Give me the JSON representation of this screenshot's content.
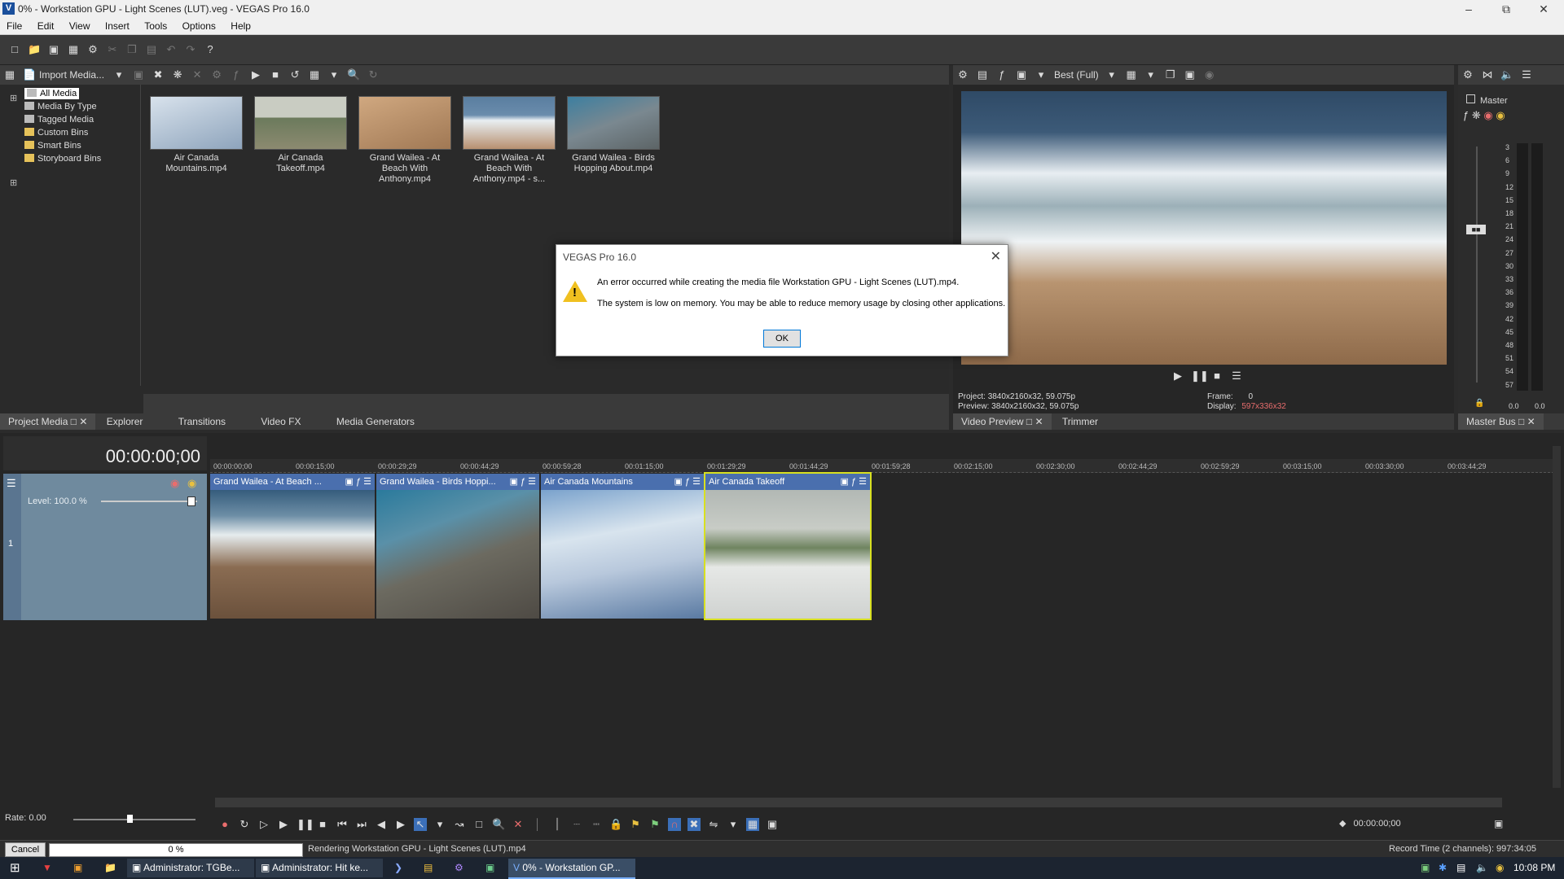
{
  "window": {
    "title": "0% - Workstation GPU - Light Scenes (LUT).veg - VEGAS Pro 16.0",
    "app_letter": "V"
  },
  "menu": [
    "File",
    "Edit",
    "View",
    "Insert",
    "Tools",
    "Options",
    "Help"
  ],
  "media_panel": {
    "import_label": "Import Media...",
    "tree": [
      "All Media",
      "Media By Type",
      "Tagged Media",
      "Custom Bins",
      "Smart Bins",
      "Storyboard Bins"
    ],
    "thumbs": [
      {
        "name": "Air Canada Mountains.mp4",
        "color": "#b8c6d4"
      },
      {
        "name": "Air Canada Takeoff.mp4",
        "color": "#8c9a88"
      },
      {
        "name": "Grand Wailea - At Beach With Anthony.mp4",
        "color": "#b08a66"
      },
      {
        "name": "Grand Wailea - At Beach With Anthony.mp4 - s...",
        "color": "#7a8ea0"
      },
      {
        "name": "Grand Wailea - Birds Hopping About.mp4",
        "color": "#6a8290"
      }
    ]
  },
  "left_tabs": [
    "Project Media",
    "Explorer",
    "Transitions",
    "Video FX",
    "Media Generators"
  ],
  "preview": {
    "quality": "Best (Full)",
    "project_label": "Project:",
    "project_value": "3840x2160x32, 59.075p",
    "preview_label": "Preview:",
    "preview_value": "3840x2160x32, 59.075p",
    "frame_label": "Frame:",
    "frame_value": "0",
    "display_label": "Display:",
    "display_value": "597x336x32",
    "tabs": [
      "Video Preview",
      "Trimmer"
    ]
  },
  "master": {
    "label": "Master",
    "scale": [
      "3",
      "6",
      "9",
      "12",
      "15",
      "18",
      "21",
      "24",
      "27",
      "30",
      "33",
      "36",
      "39",
      "42",
      "45",
      "48",
      "51",
      "54",
      "57"
    ],
    "left_value": "0.0",
    "right_value": "0.0",
    "tab": "Master Bus"
  },
  "dialog": {
    "title": "VEGAS Pro 16.0",
    "line1": "An error occurred while creating the media file Workstation GPU - Light Scenes (LUT).mp4.",
    "line2": "The system is low on memory. You may be able to reduce memory usage by closing other applications.",
    "ok": "OK"
  },
  "timeline": {
    "timecode": "00:00:00;00",
    "level": "Level: 100.0 %",
    "ruler": [
      "00:00:00;00",
      "00:00:15;00",
      "00:00:29;29",
      "00:00:44;29",
      "00:00:59;28",
      "00:01:15;00",
      "00:01:29;29",
      "00:01:44;29",
      "00:01:59;28",
      "00:02:15;00",
      "00:02:30;00",
      "00:02:44;29",
      "00:02:59;29",
      "00:03:15;00",
      "00:03:30;00",
      "00:03:44;29"
    ],
    "clips": [
      {
        "name": "Grand Wailea - At Beach ...",
        "color": "#8c7560"
      },
      {
        "name": "Grand Wailea - Birds Hoppi...",
        "color": "#5f6e70"
      },
      {
        "name": "Air Canada Mountains",
        "color": "#a9b8cc"
      },
      {
        "name": "Air Canada Takeoff",
        "color": "#b9bdb4"
      }
    ],
    "rate": "Rate: 0.00",
    "cursor_time": "00:00:00;00"
  },
  "status": {
    "cancel": "Cancel",
    "progress": "0 %",
    "progress_value": 0,
    "rendering": "Rendering Workstation GPU - Light Scenes (LUT).mp4",
    "record_time": "Record Time (2 channels): 997:34:05"
  },
  "taskbar": {
    "items": [
      "Administrator: TGBe...",
      "Administrator: Hit ke...",
      "0% - Workstation GP..."
    ],
    "clock": "10:08 PM"
  }
}
